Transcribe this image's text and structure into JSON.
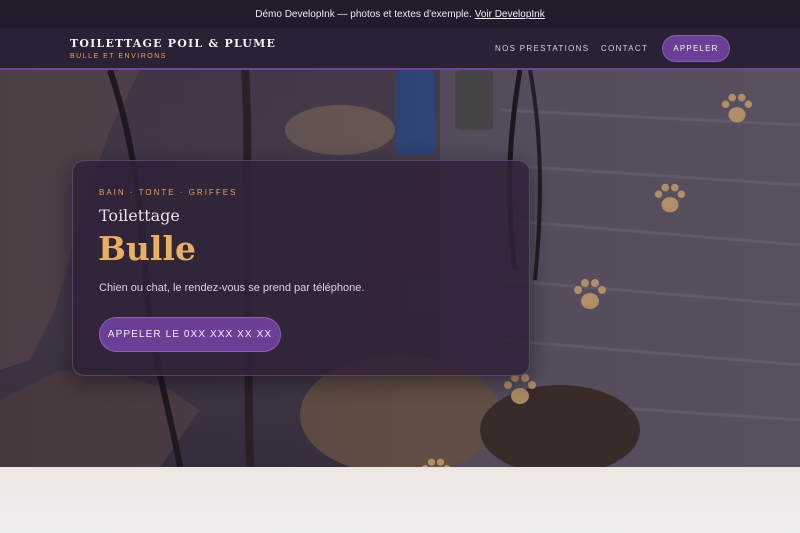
{
  "banner": {
    "text": "Démo DevelopInk — photos et textes d'exemple.",
    "link": "Voir DevelopInk"
  },
  "header": {
    "title": "TOILETTAGE POIL & PLUME",
    "subtitle": "BULLE ET ENVIRONS",
    "nav": [
      "NOS PRESTATIONS",
      "CONTACT"
    ],
    "call_label": "APPELER"
  },
  "hero": {
    "eyebrow": "BAIN · TONTE · GRIFFES",
    "title": "Toilettage",
    "name": "Bulle",
    "text": "Chien ou chat, le rendez-vous se prend par téléphone.",
    "button": "APPELER LE 0XX XXX XX XX"
  },
  "colors": {
    "accent_purple": "#6b3f96",
    "accent_gold": "#e9b062",
    "dark_bg": "#2b2136"
  },
  "icons": [
    "paw-icon"
  ]
}
